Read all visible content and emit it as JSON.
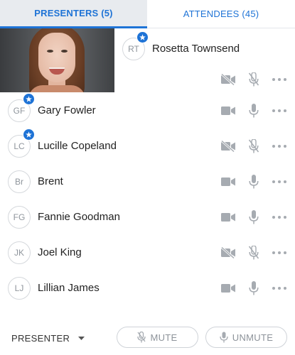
{
  "tabs": {
    "presenters_label": "PRESENTERS (5)",
    "attendees_label": "ATTENDEES (45)"
  },
  "presenters": [
    {
      "initials": "RT",
      "name": "Rosetta Townsend",
      "starred": true,
      "camera": "off",
      "mic": "off",
      "has_video": true
    },
    {
      "initials": "GF",
      "name": "Gary Fowler",
      "starred": true,
      "camera": "on",
      "mic": "on"
    },
    {
      "initials": "LC",
      "name": "Lucille Copeland",
      "starred": true,
      "camera": "off",
      "mic": "off"
    },
    {
      "initials": "Br",
      "name": "Brent",
      "starred": false,
      "camera": "on",
      "mic": "on"
    },
    {
      "initials": "FG",
      "name": "Fannie Goodman",
      "starred": false,
      "camera": "on",
      "mic": "on"
    },
    {
      "initials": "JK",
      "name": "Joel King",
      "starred": false,
      "camera": "off",
      "mic": "off"
    },
    {
      "initials": "LJ",
      "name": "Lillian James",
      "starred": false,
      "camera": "on",
      "mic": "on"
    }
  ],
  "footer": {
    "role_label": "PRESENTER",
    "mute_label": "MUTE",
    "unmute_label": "UNMUTE"
  },
  "colors": {
    "accent": "#1e73d6",
    "icon_gray": "#a6abb1",
    "tab_active_bg": "#e8ebef"
  },
  "icons": {
    "camera_on": "video-camera-icon",
    "camera_off": "video-camera-off-icon",
    "mic_on": "microphone-icon",
    "mic_off": "microphone-off-icon",
    "more": "more-dots-icon",
    "star": "star-icon",
    "caret": "caret-down-icon"
  }
}
